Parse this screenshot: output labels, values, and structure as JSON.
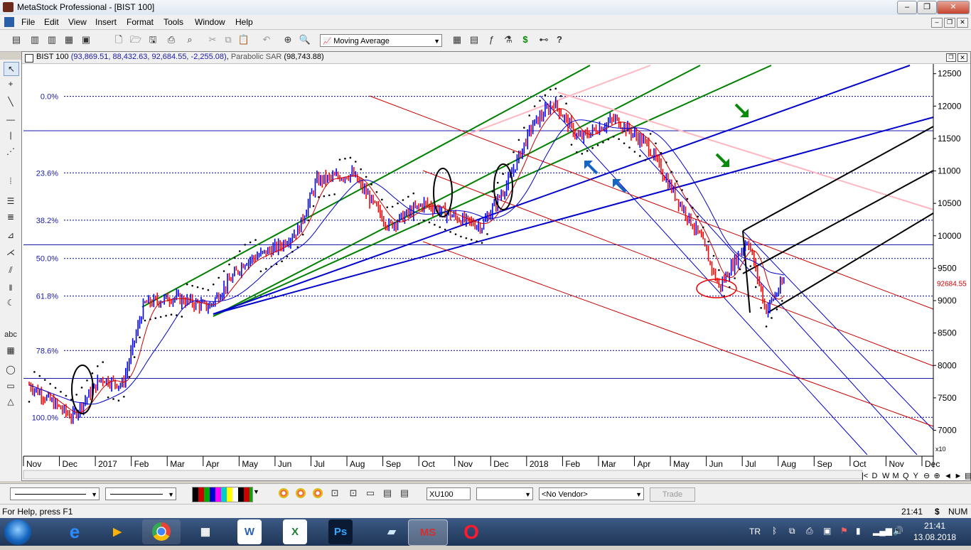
{
  "window": {
    "title": "MetaStock Professional - [BIST 100]",
    "controls": [
      "–",
      "❐",
      "✕"
    ]
  },
  "menu": [
    "File",
    "Edit",
    "View",
    "Insert",
    "Format",
    "Tools",
    "Window",
    "Help"
  ],
  "toolbar": {
    "indicator_select": "Moving Average"
  },
  "chart_header": {
    "symbol": "BIST 100",
    "ohlc": "(93,869.51, 88,432.63, 92,684.55, -2,255.08)",
    "indicator": "Parabolic SAR",
    "indicator_value": "(98,743.88)"
  },
  "chart_data": {
    "type": "line",
    "title": "BIST 100",
    "x_labels": [
      "Nov",
      "Dec",
      "2017",
      "Feb",
      "Mar",
      "Apr",
      "May",
      "Jun",
      "Jul",
      "Aug",
      "Sep",
      "Oct",
      "Nov",
      "Dec",
      "2018",
      "Feb",
      "Mar",
      "Apr",
      "May",
      "Jun",
      "Jul",
      "Aug",
      "Sep",
      "Oct",
      "Nov",
      "Dec"
    ],
    "y_ticks": [
      7000,
      7500,
      8000,
      8500,
      9000,
      9500,
      10000,
      10500,
      11000,
      11500,
      12000,
      12500
    ],
    "y_tick_labels": [
      "7000",
      "7500",
      "8000",
      "8500",
      "9000",
      "9500",
      "10000",
      "10500",
      "11000",
      "11500",
      "12000",
      "12500"
    ],
    "y_multiplier_label": "x10",
    "ylim": [
      6600,
      12650
    ],
    "last_value_label": "92684.55",
    "last_value": 9268.455,
    "fib_levels": [
      {
        "label": "0.0%",
        "value": 12150
      },
      {
        "label": "23.6%",
        "value": 10970
      },
      {
        "label": "38.2%",
        "value": 10240
      },
      {
        "label": "50.0%",
        "value": 9650
      },
      {
        "label": "61.8%",
        "value": 9070
      },
      {
        "label": "78.6%",
        "value": 8230
      },
      {
        "label": "100.0%",
        "value": 7200
      }
    ],
    "series": [
      {
        "name": "BIST 100",
        "x": [
          0,
          1.2,
          2,
          2.6,
          3.2,
          4,
          5,
          6,
          7,
          7.5,
          8,
          9,
          10,
          11,
          12,
          12.6,
          13.3,
          14,
          14.6,
          15.3,
          16.3,
          17.2,
          18,
          18.7,
          19.2,
          20,
          20.5,
          21
        ],
        "values": [
          7700,
          7200,
          7800,
          7700,
          8950,
          9050,
          8900,
          9600,
          9850,
          10100,
          10850,
          10950,
          10150,
          10500,
          10250,
          10150,
          10800,
          11700,
          12050,
          11500,
          11800,
          11400,
          10600,
          9950,
          9200,
          9950,
          8850,
          9300
        ]
      }
    ],
    "colors": {
      "up": "#0000ff",
      "down": "#ff0000",
      "sar": "#000000",
      "fib": "#000080"
    }
  },
  "bottom_toolbar": {
    "symbol": "XU100",
    "vendor": "<No Vendor>",
    "trade_button": "Trade"
  },
  "status": {
    "help": "For Help, press F1",
    "time": "21:41",
    "currency": "$",
    "numlock": "NUM"
  },
  "taskbar": {
    "language": "TR",
    "clock_time": "21:41",
    "clock_date": "13.08.2018"
  }
}
